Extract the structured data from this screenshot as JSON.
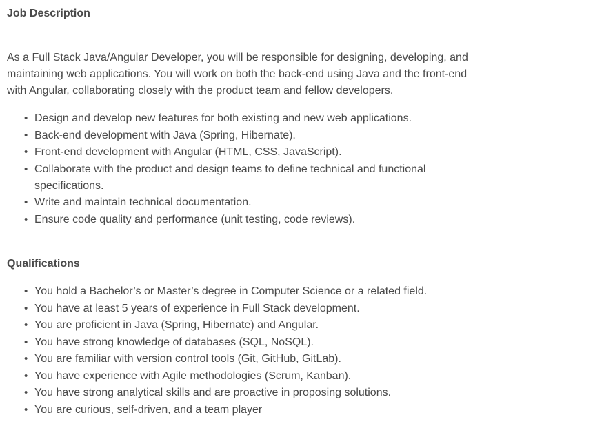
{
  "job_description": {
    "title": "Job Description",
    "intro": "As a Full Stack Java/Angular Developer, you will be responsible for designing, developing, and maintaining web applications. You will work on both the back-end using Java and the front-end with Angular, collaborating closely with the product team and fellow developers.",
    "responsibilities": [
      "Design and develop new features for both existing and new web applications.",
      "Back-end development with Java (Spring, Hibernate).",
      "Front-end development with Angular (HTML, CSS, JavaScript).",
      "Collaborate with the product and design teams to define technical and functional specifications.",
      "Write and maintain technical documentation.",
      "Ensure code quality and performance (unit testing, code reviews)."
    ]
  },
  "qualifications": {
    "title": "Qualifications",
    "items": [
      "You hold a Bachelor’s or Master’s degree in Computer Science or a related field.",
      "You have at least 5 years of experience in Full Stack development.",
      "You are proficient in Java (Spring, Hibernate) and Angular.",
      "You have strong knowledge of databases (SQL, NoSQL).",
      "You are familiar with version control tools (Git, GitHub, GitLab).",
      "You have experience with Agile methodologies (Scrum, Kanban).",
      "You have strong analytical skills and are proactive in proposing solutions.",
      "You are curious, self-driven, and a team player"
    ]
  }
}
